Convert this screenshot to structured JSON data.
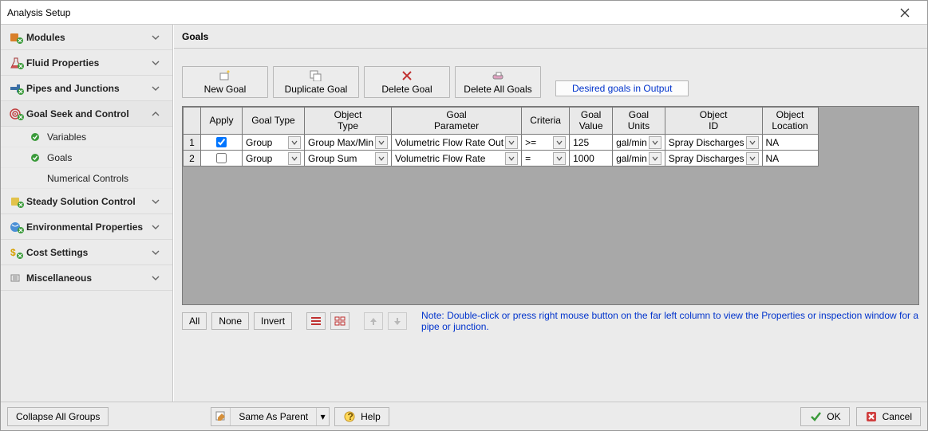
{
  "window": {
    "title": "Analysis Setup"
  },
  "sidebar": {
    "items": [
      {
        "label": "Modules",
        "name": "nav-modules"
      },
      {
        "label": "Fluid Properties",
        "name": "nav-fluid-properties"
      },
      {
        "label": "Pipes and Junctions",
        "name": "nav-pipes-junctions"
      },
      {
        "label": "Goal Seek and Control",
        "name": "nav-goal-seek-control"
      },
      {
        "label": "Steady Solution Control",
        "name": "nav-steady-solution"
      },
      {
        "label": "Environmental Properties",
        "name": "nav-environmental"
      },
      {
        "label": "Cost Settings",
        "name": "nav-cost-settings"
      },
      {
        "label": "Miscellaneous",
        "name": "nav-miscellaneous"
      }
    ],
    "subs": [
      {
        "label": "Variables",
        "name": "nav-sub-variables"
      },
      {
        "label": "Goals",
        "name": "nav-sub-goals"
      },
      {
        "label": "Numerical Controls",
        "name": "nav-sub-numerical-controls"
      }
    ]
  },
  "main": {
    "title": "Goals"
  },
  "toolbar": {
    "new": "New Goal",
    "duplicate": "Duplicate Goal",
    "delete": "Delete Goal",
    "delete_all": "Delete All Goals",
    "link": "Desired goals in Output"
  },
  "grid": {
    "headers": [
      "",
      "Apply",
      "Goal Type",
      "Object\nType",
      "Goal\nParameter",
      "Criteria",
      "Goal\nValue",
      "Goal\nUnits",
      "Object\nID",
      "Object\nLocation"
    ],
    "rows": [
      {
        "n": "1",
        "apply": true,
        "goal_type": "Group",
        "object_type": "Group Max/Min",
        "parameter": "Volumetric Flow Rate Out",
        "criteria": ">=",
        "value": "125",
        "units": "gal/min",
        "object_id": "Spray Discharges",
        "location": "NA"
      },
      {
        "n": "2",
        "apply": false,
        "goal_type": "Group",
        "object_type": "Group Sum",
        "parameter": "Volumetric Flow Rate",
        "criteria": "=",
        "value": "1000",
        "units": "gal/min",
        "object_id": "Spray Discharges",
        "location": "NA"
      }
    ]
  },
  "below": {
    "all": "All",
    "none": "None",
    "invert": "Invert",
    "note": "Note: Double-click or press right mouse button on the far left column to view the Properties or inspection window for a pipe or junction."
  },
  "footer": {
    "collapse": "Collapse All Groups",
    "same_as_parent": "Same As Parent",
    "help": "Help",
    "ok": "OK",
    "cancel": "Cancel"
  }
}
